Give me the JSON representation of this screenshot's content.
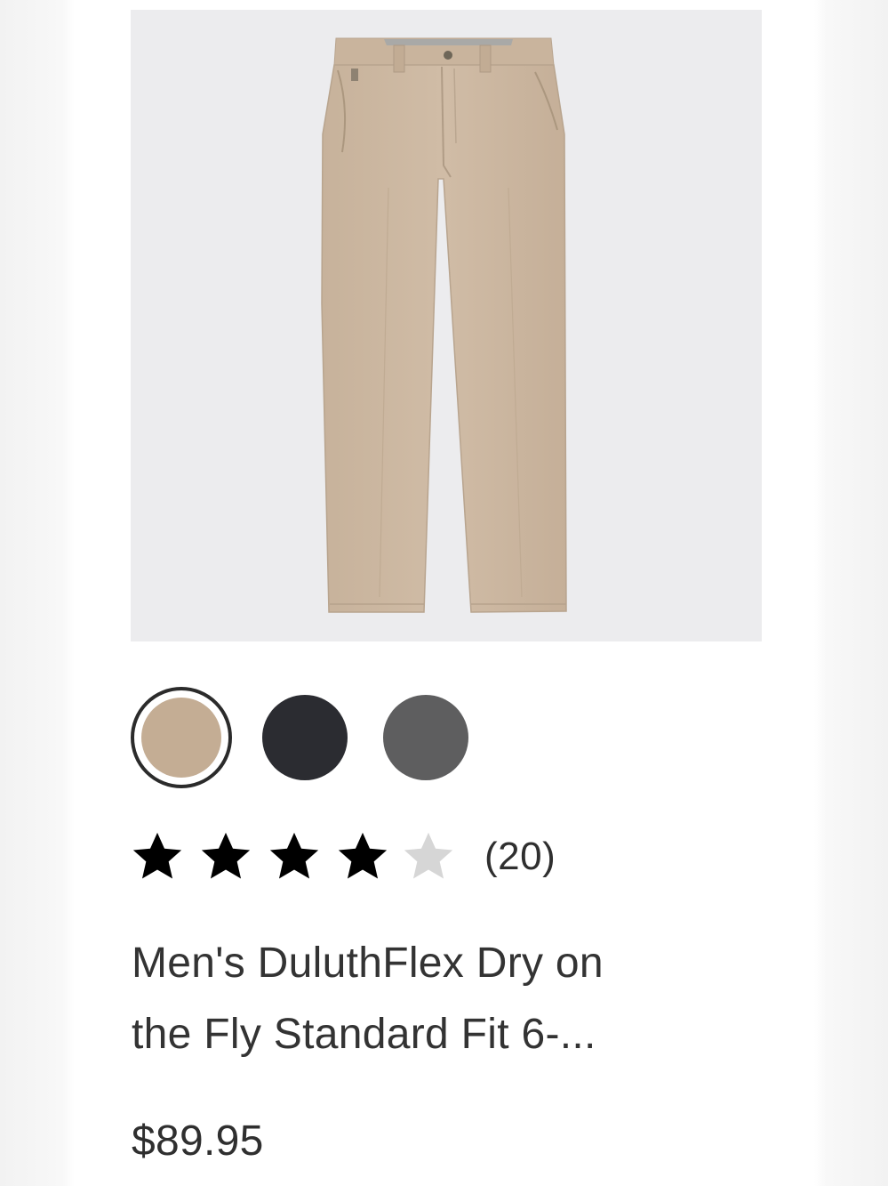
{
  "product": {
    "image_alt": "Men's DuluthFlex Dry on the Fly Standard Fit pants in khaki",
    "swatches": [
      {
        "name": "khaki",
        "color": "#c4ad94",
        "selected": true
      },
      {
        "name": "black",
        "color": "#2b2c31",
        "selected": false
      },
      {
        "name": "gray",
        "color": "#5e5e5f",
        "selected": false
      }
    ],
    "rating": {
      "value": 4,
      "max": 5,
      "filled_color": "#000000",
      "empty_color": "#d6d6d6",
      "review_count_text": "(20)"
    },
    "title_line1": "Men's DuluthFlex Dry on",
    "title_line2": "the Fly Standard Fit 6-...",
    "price": "$89.95"
  },
  "colors": {
    "image_background": "#ececee",
    "pants": "#cdb8a2",
    "text": "#333333"
  }
}
